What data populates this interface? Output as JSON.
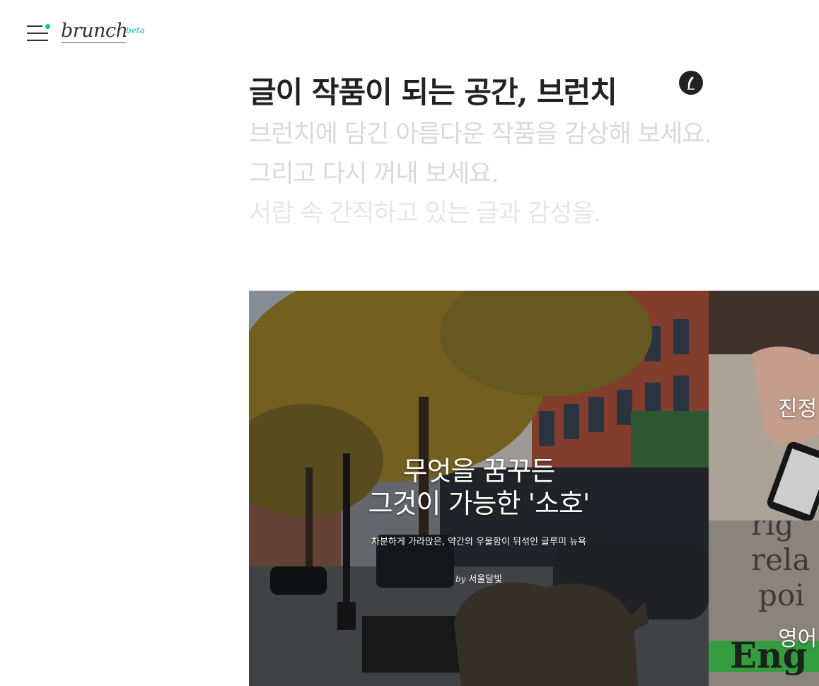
{
  "header": {
    "logo_text": "brunch",
    "logo_badge": "beta",
    "menu_icon": "hamburger-menu-icon",
    "accent_color": "#00c6be"
  },
  "intro": {
    "title": "글이 작품이 되는 공간, 브런치",
    "lines": [
      "브런치에 담긴 아름다운 작품을 감상해 보세요.",
      "그리고 다시 꺼내 보세요.",
      "서랍 속 간직하고 있는 글과 감성을."
    ],
    "badge_icon": "pen-nib-icon"
  },
  "featured": {
    "main": {
      "title_line1": "무엇을 꿈꾸든",
      "title_line2": "그것이 가능한 '소호'",
      "description": "차분하게 가라앉은, 약간의 우울함이 뒤섞인 글루미 뉴욕",
      "author_prefix": "by",
      "author": "서울달빛"
    },
    "side": [
      {
        "title": "진정"
      },
      {
        "title": "영어"
      }
    ]
  }
}
